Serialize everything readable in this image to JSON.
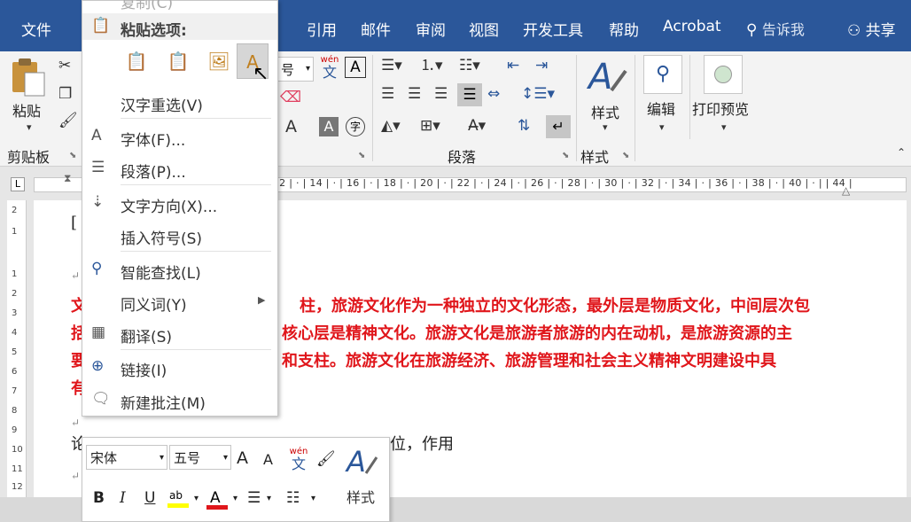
{
  "tabs": {
    "file": "文件",
    "references": "引用",
    "mailings": "邮件",
    "review": "审阅",
    "view": "视图",
    "developer": "开发工具",
    "help": "帮助",
    "acrobat": "Acrobat",
    "tell_me": "告诉我",
    "share": "共享"
  },
  "ribbon": {
    "paste_label": "粘贴",
    "clipboard_label": "剪贴板",
    "font_size_value": "号",
    "phonetic_top": "wén",
    "phonetic_char": "文",
    "boxed_a": "A",
    "shrink_a": "A",
    "char_shading_a": "A",
    "enclose_char": "字",
    "paragraph_label": "段落",
    "styles_label": "样式",
    "styles_group_label": "样式",
    "edit_label": "编辑",
    "print_preview_label": "打印预览"
  },
  "ruler": {
    "ticks": "| 12 | · | 14 | · | 16 | · | 18 | · | 20 | · | 22 | · | 24 | · | 26 | · | 28 | · | 30 | · | 32 | · | 34 | · | 36 | · | 38 | · | 40 | · |  | 44 |"
  },
  "vruler": [
    "2",
    "1",
    "",
    "1",
    "2",
    "3",
    "4",
    "5",
    "6",
    "7",
    "8",
    "9",
    "10",
    "11",
    "12"
  ],
  "document": {
    "bracket_text": "[",
    "para_mark": "↵",
    "red_line1_a": "文",
    "red_line1_b": "柱，旅游文化作为一种独立的文化形态，最外层是物质文化，中间层次包",
    "red_line2_a": "括",
    "red_line2_b": "核心层是精神文化。旅游文化是旅游者旅游的内在动机，是旅游资源的主",
    "red_line3_a": "要",
    "red_line3_b": "和支柱。旅游文化在旅游经济、旅游管理和社会主义精神文明建设中具",
    "red_line4_a": "有",
    "black_line_a": "论",
    "black_line_b": "位，作用"
  },
  "context_menu": {
    "copy_partial": "复制(C)",
    "paste_options_header": "粘贴选项:",
    "reconvert": "汉字重选(V)",
    "font": "字体(F)...",
    "paragraph": "段落(P)...",
    "text_direction": "文字方向(X)...",
    "insert_symbol": "插入符号(S)",
    "smart_lookup": "智能查找(L)",
    "synonyms": "同义词(Y)",
    "translate": "翻译(S)",
    "link": "链接(I)",
    "new_comment": "新建批注(M)"
  },
  "mini_toolbar": {
    "font_name": "宋体",
    "font_size": "五号",
    "grow_font": "A",
    "shrink_font": "A",
    "phonetic_top": "wén",
    "phonetic_char": "文",
    "bold": "B",
    "italic": "I",
    "underline": "U",
    "highlight_ab": "ab",
    "font_color_a": "A",
    "styles_label": "样式"
  },
  "colors": {
    "tab_bar": "#2b579a",
    "accent_red": "#e0161b",
    "highlight_yellow": "#ffff00"
  }
}
